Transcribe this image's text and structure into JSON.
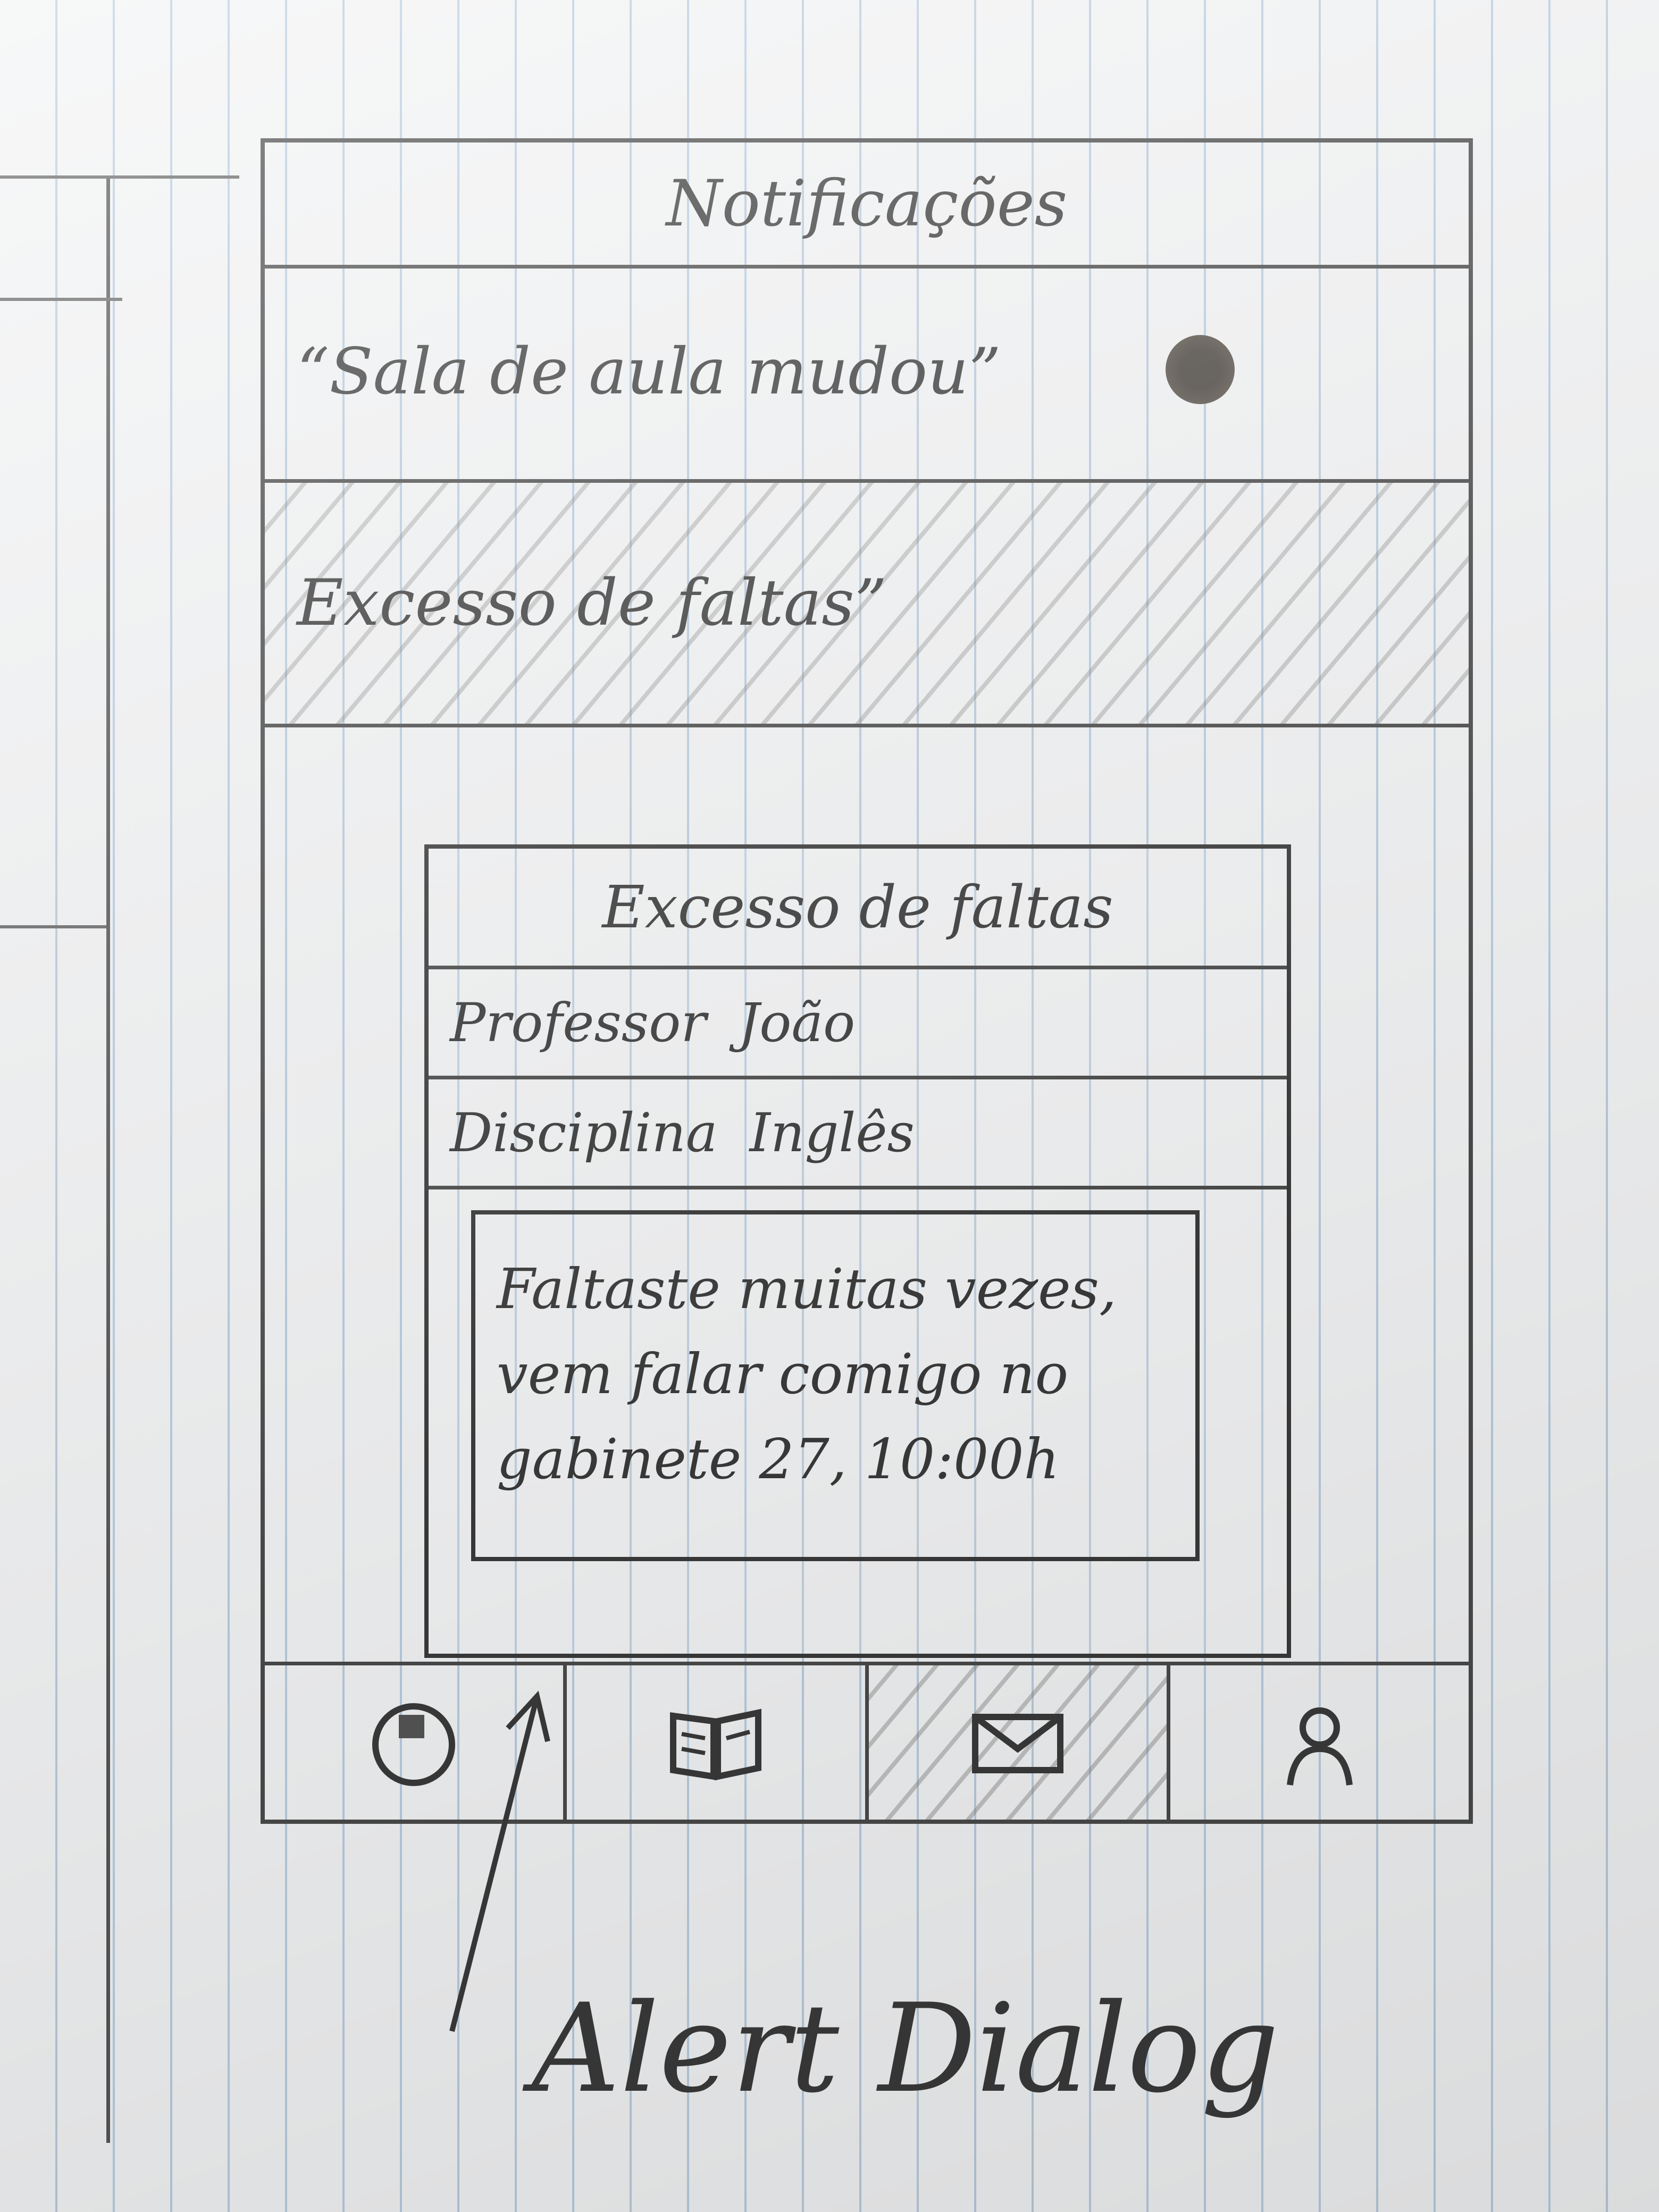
{
  "header": {
    "title": "Notificações"
  },
  "notifications": [
    {
      "text": "“Sala de aula mudou”",
      "unread": true
    },
    {
      "text": "Excesso de faltas”",
      "selected": true
    }
  ],
  "dialog": {
    "title": "Excesso de faltas",
    "professor_label": "Professor",
    "professor_value": "João",
    "discipline_label": "Disciplina",
    "discipline_value": "Inglês",
    "message_line1": "Faltaste muitas vezes,",
    "message_line2": "vem falar comigo no",
    "message_line3": "gabinete 27, 10:00h"
  },
  "bottom_nav": {
    "items": [
      {
        "icon": "clock-icon"
      },
      {
        "icon": "book-icon"
      },
      {
        "icon": "mail-icon",
        "active": true
      },
      {
        "icon": "profile-icon"
      }
    ]
  },
  "annotation": {
    "text": "Alert Dialog"
  },
  "colors": {
    "ink": "#3a3a3a",
    "paper": "#f3f4f5",
    "rule": "#b9cde0"
  }
}
